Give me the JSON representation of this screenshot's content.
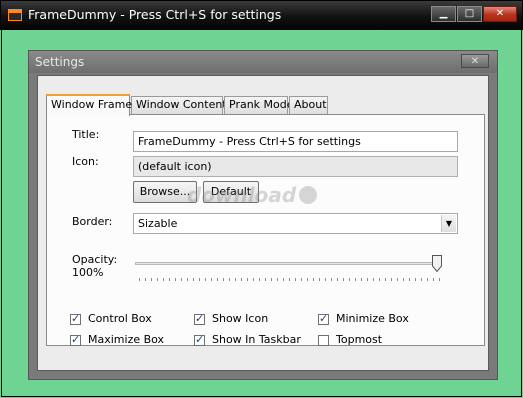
{
  "window": {
    "title": "FrameDummy - Press Ctrl+S for settings",
    "minimize_glyph": "▁",
    "maximize_glyph": "□",
    "close_glyph": "✕"
  },
  "dialog": {
    "title": "Settings",
    "close_glyph": "✕"
  },
  "tabs": [
    {
      "label": "Window Frame",
      "active": true
    },
    {
      "label": "Window Content",
      "active": false
    },
    {
      "label": "Prank Mode",
      "active": false
    },
    {
      "label": "About",
      "active": false
    }
  ],
  "form": {
    "title_label": "Title:",
    "title_value": "FrameDummy - Press Ctrl+S for settings",
    "icon_label": "Icon:",
    "icon_value": "(default icon)",
    "browse_label": "Browse...",
    "default_label": "Default",
    "border_label": "Border:",
    "border_value": "Sizable",
    "opacity_label": "Opacity:",
    "opacity_value": "100%",
    "opacity_level": 1.0
  },
  "checkboxes": [
    {
      "label": "Control Box",
      "checked": true
    },
    {
      "label": "Show Icon",
      "checked": true
    },
    {
      "label": "Minimize Box",
      "checked": true
    },
    {
      "label": "Maximize Box",
      "checked": true
    },
    {
      "label": "Show In Taskbar",
      "checked": true
    },
    {
      "label": "Topmost",
      "checked": false
    }
  ],
  "watermark": "download"
}
